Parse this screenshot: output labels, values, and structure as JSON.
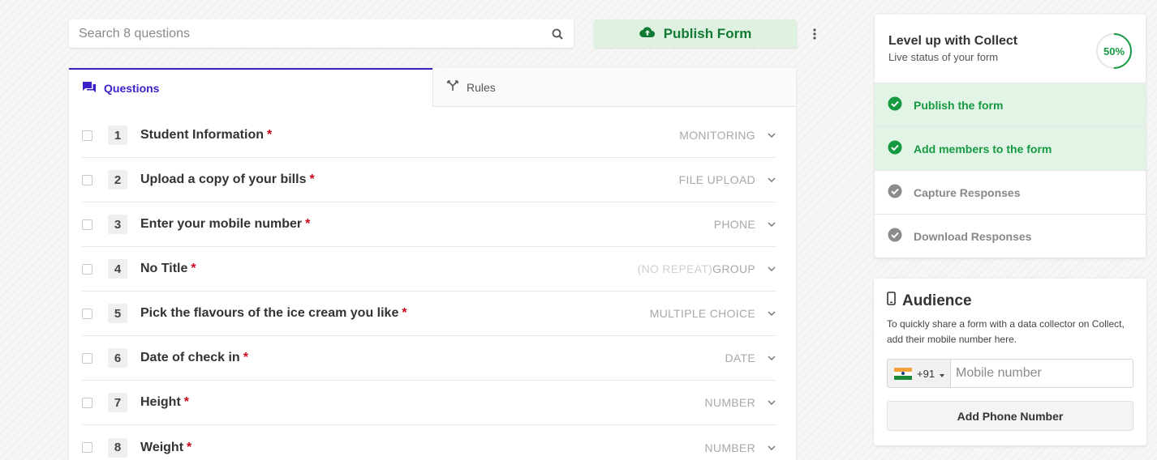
{
  "search": {
    "placeholder": "Search 8 questions",
    "icon": "search-icon"
  },
  "toolbar": {
    "publish_label": "Publish Form",
    "publish_icon": "cloud-upload-icon",
    "more_icon": "kebab-icon"
  },
  "tabs": [
    {
      "label": "Questions",
      "icon": "chat-icon",
      "active": true
    },
    {
      "label": "Rules",
      "icon": "branch-icon",
      "active": false
    }
  ],
  "questions": [
    {
      "num": "1",
      "title": "Student Information",
      "required": "*",
      "type_muted": "",
      "type": "MONITORING"
    },
    {
      "num": "2",
      "title": "Upload a copy of your bills",
      "required": "*",
      "type_muted": "",
      "type": "FILE UPLOAD"
    },
    {
      "num": "3",
      "title": "Enter your mobile number",
      "required": "*",
      "type_muted": "",
      "type": "PHONE"
    },
    {
      "num": "4",
      "title": "No Title",
      "required": "*",
      "type_muted": "(NO REPEAT)",
      "type": "GROUP"
    },
    {
      "num": "5",
      "title": "Pick the flavours of the ice cream you like",
      "required": "*",
      "type_muted": "",
      "type": "MULTIPLE CHOICE"
    },
    {
      "num": "6",
      "title": "Date of check in",
      "required": "*",
      "type_muted": "",
      "type": "DATE"
    },
    {
      "num": "7",
      "title": "Height",
      "required": "*",
      "type_muted": "",
      "type": "NUMBER"
    },
    {
      "num": "8",
      "title": "Weight",
      "required": "*",
      "type_muted": "",
      "type": "NUMBER"
    }
  ],
  "levelup": {
    "title": "Level up with Collect",
    "subtitle": "Live status of your form",
    "progress_label": "50%",
    "progress_fraction": 0.5,
    "steps": [
      {
        "label": "Publish the form",
        "done": true
      },
      {
        "label": "Add members to the form",
        "done": true
      },
      {
        "label": "Capture Responses",
        "done": false
      },
      {
        "label": "Download Responses",
        "done": false
      }
    ]
  },
  "audience": {
    "title": "Audience",
    "description": "To quickly share a form with a data collector on Collect, add their mobile number here.",
    "country_code": "+91",
    "phone_placeholder": "Mobile number",
    "add_label": "Add Phone Number"
  },
  "colors": {
    "accent": "#3d1fc9",
    "success": "#159a41",
    "required": "#d0021b",
    "publish_bg": "#dff2e1"
  }
}
